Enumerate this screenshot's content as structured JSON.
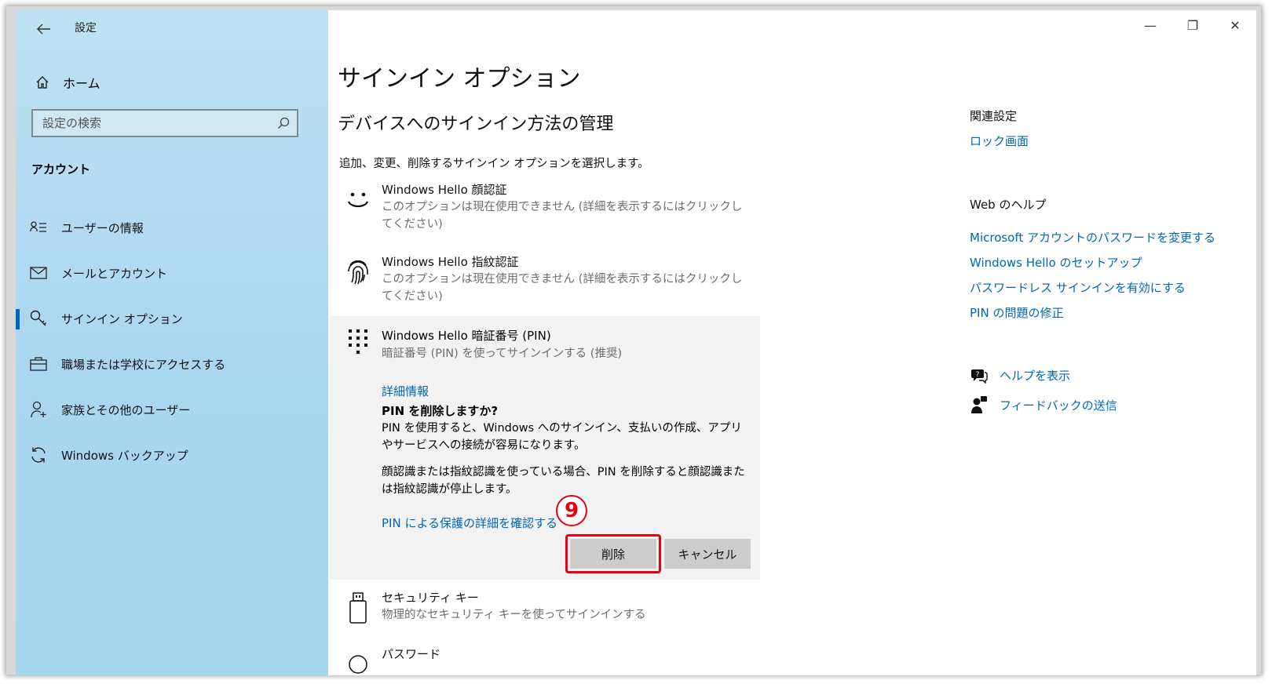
{
  "window": {
    "title": "設定",
    "controls": [
      "—",
      "❐",
      "✕"
    ]
  },
  "sidebar": {
    "home": "ホーム",
    "search_placeholder": "設定の検索",
    "section": "アカウント",
    "items": [
      {
        "label": "ユーザーの情報",
        "icon": "person-list-icon"
      },
      {
        "label": "メールとアカウント",
        "icon": "mail-icon"
      },
      {
        "label": "サインイン オプション",
        "icon": "key-icon",
        "active": true
      },
      {
        "label": "職場または学校にアクセスする",
        "icon": "briefcase-icon"
      },
      {
        "label": "家族とその他のユーザー",
        "icon": "person-add-icon"
      },
      {
        "label": "Windows バックアップ",
        "icon": "sync-icon"
      }
    ]
  },
  "main": {
    "title": "サインイン オプション",
    "subtitle": "デバイスへのサインイン方法の管理",
    "description": "追加、変更、削除するサインイン オプションを選択します。",
    "options": [
      {
        "name": "Windows Hello 顔認証",
        "sub": "このオプションは現在使用できません (詳細を表示するにはクリックしてください)"
      },
      {
        "name": "Windows Hello 指紋認証",
        "sub": "このオプションは現在使用できません (詳細を表示するにはクリックしてください)"
      },
      {
        "name": "Windows Hello 暗証番号 (PIN)",
        "sub": "暗証番号 (PIN) を使ってサインインする (推奨)"
      },
      {
        "name": "セキュリティ キー",
        "sub": "物理的なセキュリティ キーを使ってサインインする"
      },
      {
        "name": "パスワード",
        "sub": ""
      }
    ],
    "pin_panel": {
      "details_link": "詳細情報",
      "question": "PIN を削除しますか?",
      "para1": "PIN を使用すると、Windows へのサインイン、支払いの作成、アプリやサービスへの接続が容易になります。",
      "para2": "顔認識または指紋認識を使っている場合、PIN を削除すると顔認識または指紋認識が停止します。",
      "protection_link": "PIN による保護の詳細を確認する",
      "delete_button": "削除",
      "cancel_button": "キャンセル",
      "step_marker": "9"
    }
  },
  "related": {
    "related_heading": "関連設定",
    "lock_screen": "ロック画面",
    "web_help_heading": "Web のヘルプ",
    "web_links": [
      "Microsoft アカウントのパスワードを変更する",
      "Windows Hello のセットアップ",
      "パスワードレス サインインを有効にする",
      "PIN の問題の修正"
    ],
    "help": "ヘルプを表示",
    "feedback": "フィードバックの送信"
  }
}
